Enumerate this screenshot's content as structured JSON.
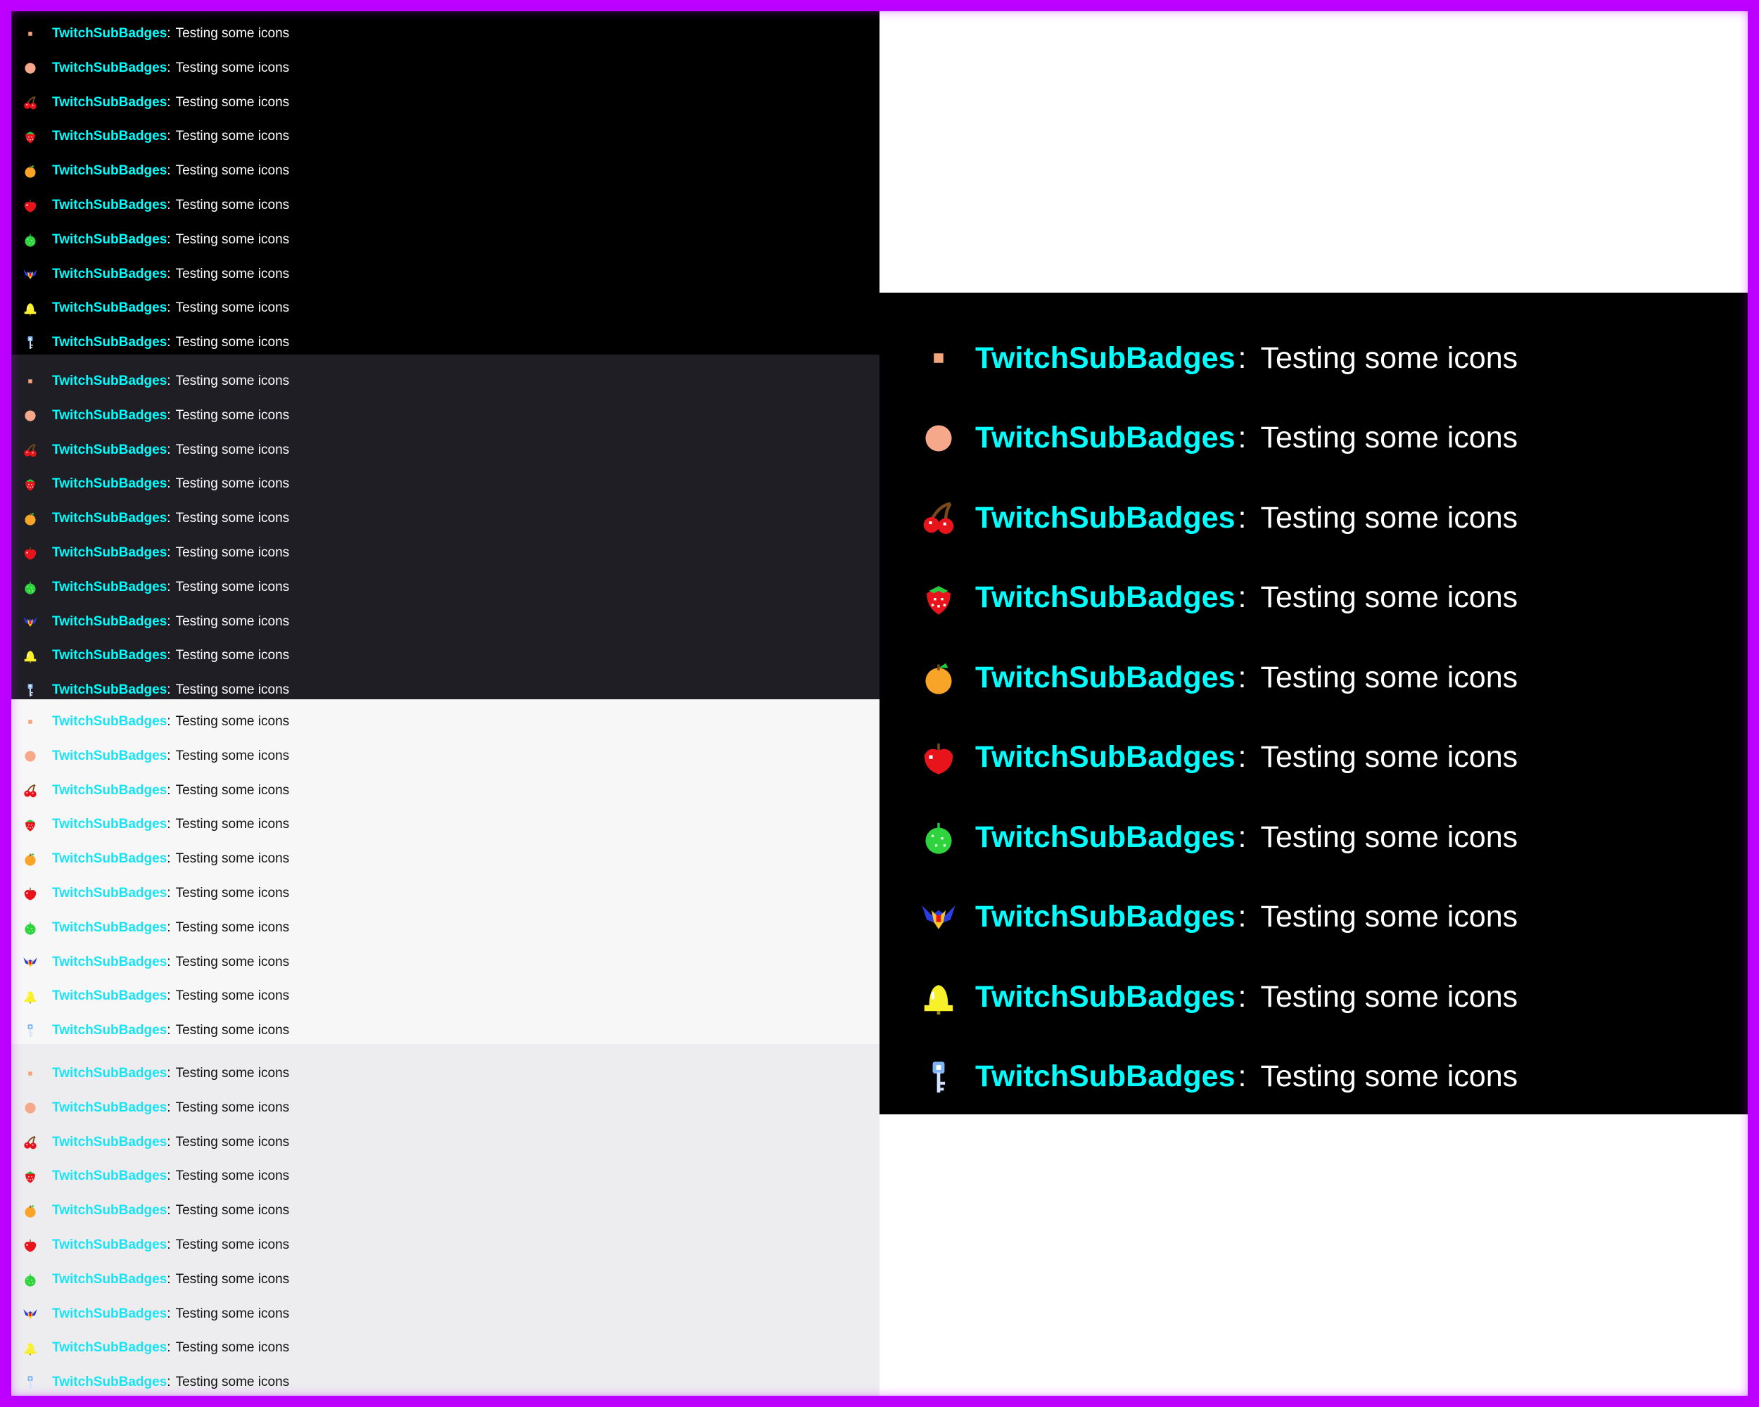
{
  "username": "TwitchSubBadges",
  "separator": ":",
  "message": "Testing some icons",
  "colors": {
    "frame": "#b900ff",
    "username_dark": "#00ffff",
    "username_light": "#19e3f2",
    "panel_black": "#000000",
    "panel_dark_gray": "#1f1e25",
    "panel_light": "#f7f7f8",
    "panel_light_gray": "#ededf0"
  },
  "badges": [
    "small-square-badge-icon",
    "peach-dot-badge-icon",
    "cherry-badge-icon",
    "strawberry-badge-icon",
    "orange-badge-icon",
    "apple-badge-icon",
    "melon-badge-icon",
    "galaxian-badge-icon",
    "bell-badge-icon",
    "key-badge-icon"
  ],
  "panels": [
    {
      "id": "dark-black",
      "theme": "dark"
    },
    {
      "id": "dark-gray",
      "theme": "dark"
    },
    {
      "id": "light-white",
      "theme": "light"
    },
    {
      "id": "light-gray",
      "theme": "light"
    }
  ],
  "zoomed_panel": {
    "theme": "dark"
  }
}
